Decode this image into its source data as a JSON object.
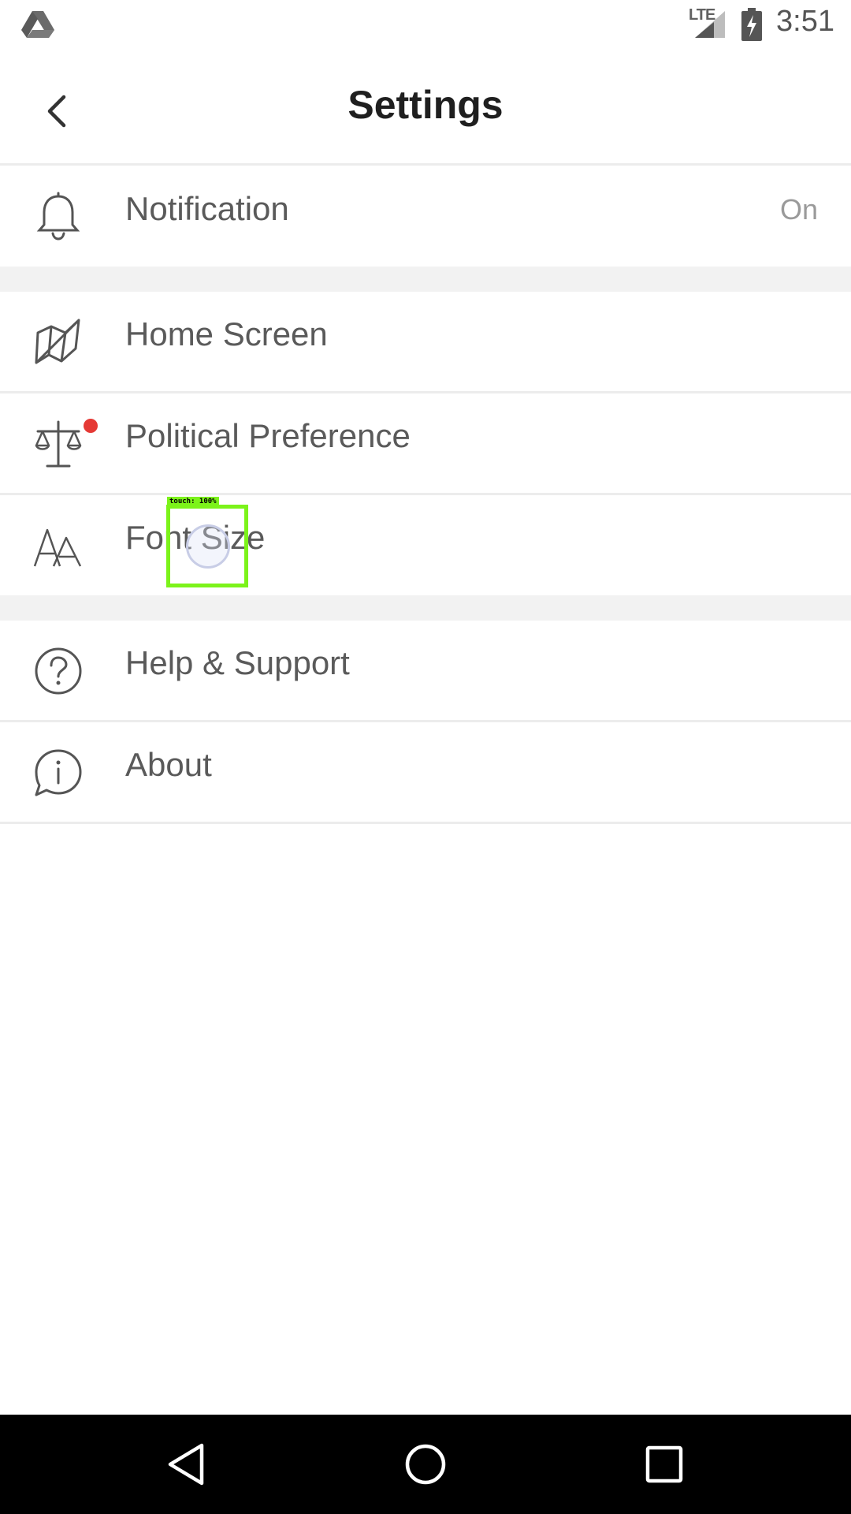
{
  "status_bar": {
    "network_label": "LTE",
    "time": "3:51",
    "icons": [
      "drive-icon",
      "signal-icon",
      "battery-charging-icon"
    ]
  },
  "header": {
    "title": "Settings",
    "back_icon": "chevron-left-icon"
  },
  "settings": {
    "notification": {
      "label": "Notification",
      "value": "On",
      "icon": "bell-icon"
    },
    "home_screen": {
      "label": "Home Screen",
      "icon": "map-icon"
    },
    "political_preference": {
      "label": "Political Preference",
      "icon": "balance-scale-icon",
      "has_badge": true
    },
    "font_size": {
      "label": "Font Size",
      "icon": "font-size-icon"
    },
    "help_support": {
      "label": "Help & Support",
      "icon": "question-circle-icon"
    },
    "about": {
      "label": "About",
      "icon": "info-bubble-icon"
    }
  },
  "touch_indicator": {
    "label": "touch: 100%"
  },
  "nav_bar": {
    "icons": [
      "nav-back-icon",
      "nav-home-icon",
      "nav-recents-icon"
    ]
  },
  "colors": {
    "badge": "#e53935",
    "divider": "#ececec",
    "section_gap": "#f2f2f2",
    "touch_highlight": "#7cf31a"
  }
}
